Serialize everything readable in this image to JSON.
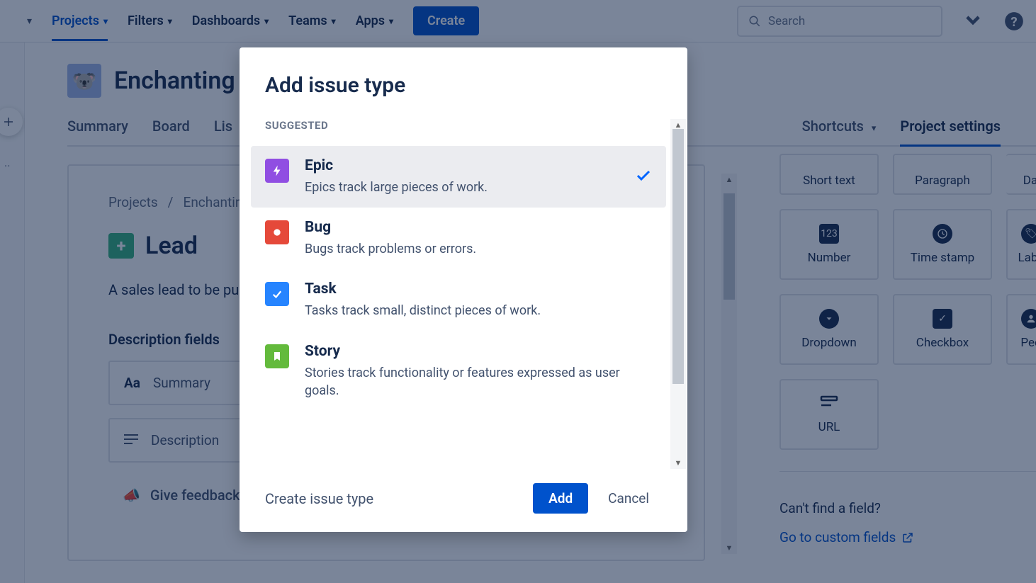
{
  "nav": {
    "projects": "Projects",
    "filters": "Filters",
    "dashboards": "Dashboards",
    "teams": "Teams",
    "apps": "Apps",
    "create": "Create",
    "search_placeholder": "Search"
  },
  "project": {
    "name": "Enchanting",
    "tabs": {
      "summary": "Summary",
      "board": "Board",
      "list": "Lis",
      "shortcuts": "Shortcuts",
      "settings": "Project settings"
    }
  },
  "breadcrumbs": {
    "a": "Projects",
    "sep": "/",
    "b": "Enchantir"
  },
  "lead": {
    "title": "Lead",
    "desc": "A sales lead to be pu",
    "section": "Description fields",
    "field_summary": "Summary",
    "field_description": "Description",
    "feedback": "Give feedback"
  },
  "fields": {
    "short_text": "Short text",
    "paragraph": "Paragraph",
    "da": "Da",
    "number": "Number",
    "timestamp": "Time stamp",
    "labels": "Labe",
    "dropdown": "Dropdown",
    "checkbox": "Checkbox",
    "people": "Peo",
    "url": "URL",
    "cant_find": "Can't find a field?",
    "custom_link": "Go to custom fields"
  },
  "modal": {
    "title": "Add issue type",
    "suggested": "SUGGESTED",
    "create_link": "Create issue type",
    "add_btn": "Add",
    "cancel_btn": "Cancel",
    "types": [
      {
        "name": "Epic",
        "desc": "Epics track large pieces of work."
      },
      {
        "name": "Bug",
        "desc": "Bugs track problems or errors."
      },
      {
        "name": "Task",
        "desc": "Tasks track small, distinct pieces of work."
      },
      {
        "name": "Story",
        "desc": "Stories track functionality or features expressed as user goals."
      }
    ]
  }
}
